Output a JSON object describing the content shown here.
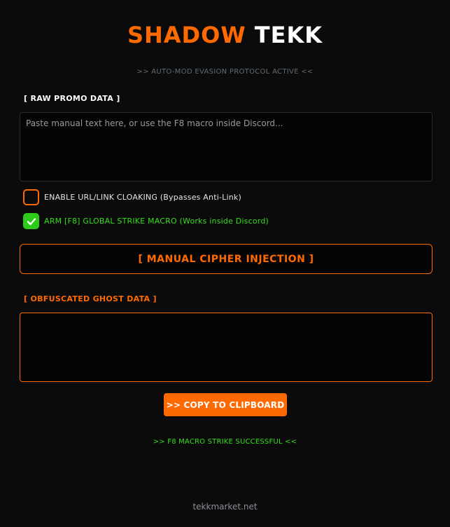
{
  "header": {
    "title_part1": "SHADOW",
    "title_part2": "TEKK",
    "subtitle": ">> AUTO-MOD EVASION PROTOCOL ACTIVE <<"
  },
  "raw_section": {
    "label": "[ RAW PROMO DATA ]",
    "placeholder": "Paste manual text here, or use the F8 macro inside Discord...",
    "value": ""
  },
  "options": {
    "cloaking": {
      "label": "ENABLE URL/LINK CLOAKING (Bypasses Anti-Link)",
      "checked": false
    },
    "macro": {
      "label": "ARM [F8] GLOBAL STRIKE MACRO (Works inside Discord)",
      "checked": true
    }
  },
  "inject_button": {
    "label": "[ MANUAL CIPHER INJECTION ]"
  },
  "ghost_section": {
    "label": "[ OBFUSCATED GHOST DATA ]",
    "value": ""
  },
  "copy_button": {
    "label": ">> COPY TO CLIPBOARD"
  },
  "status": {
    "text": ">> F8 MACRO STRIKE SUCCESSFUL <<"
  },
  "footer": {
    "link_text": "tekkmarket.net"
  },
  "colors": {
    "accent": "#ff6a00",
    "success": "#33e01a",
    "background": "#0b0b0b"
  }
}
